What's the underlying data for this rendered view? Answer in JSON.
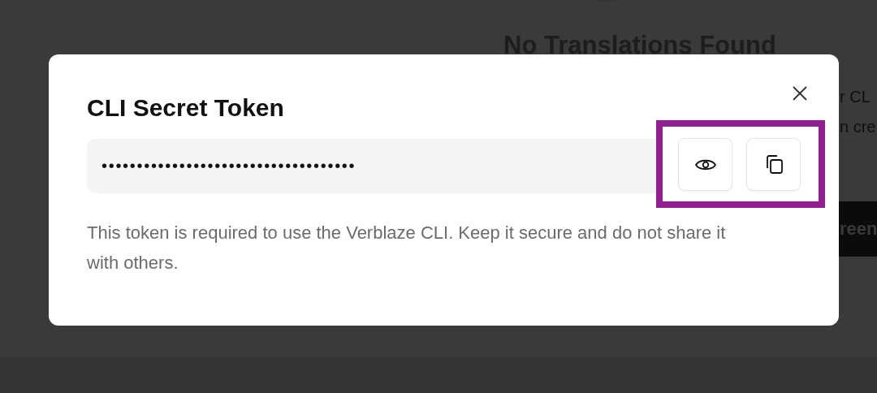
{
  "background": {
    "heading": "No Translations Found",
    "line_1": "r CL",
    "line_2": "n cre",
    "button": "reen"
  },
  "dialog": {
    "title": "CLI Secret Token",
    "token": "••••••••••••••••••••••••••••••••••••",
    "revealed": false,
    "description": "This token is required to use the Verblaze CLI. Keep it secure and do not share it with others."
  }
}
